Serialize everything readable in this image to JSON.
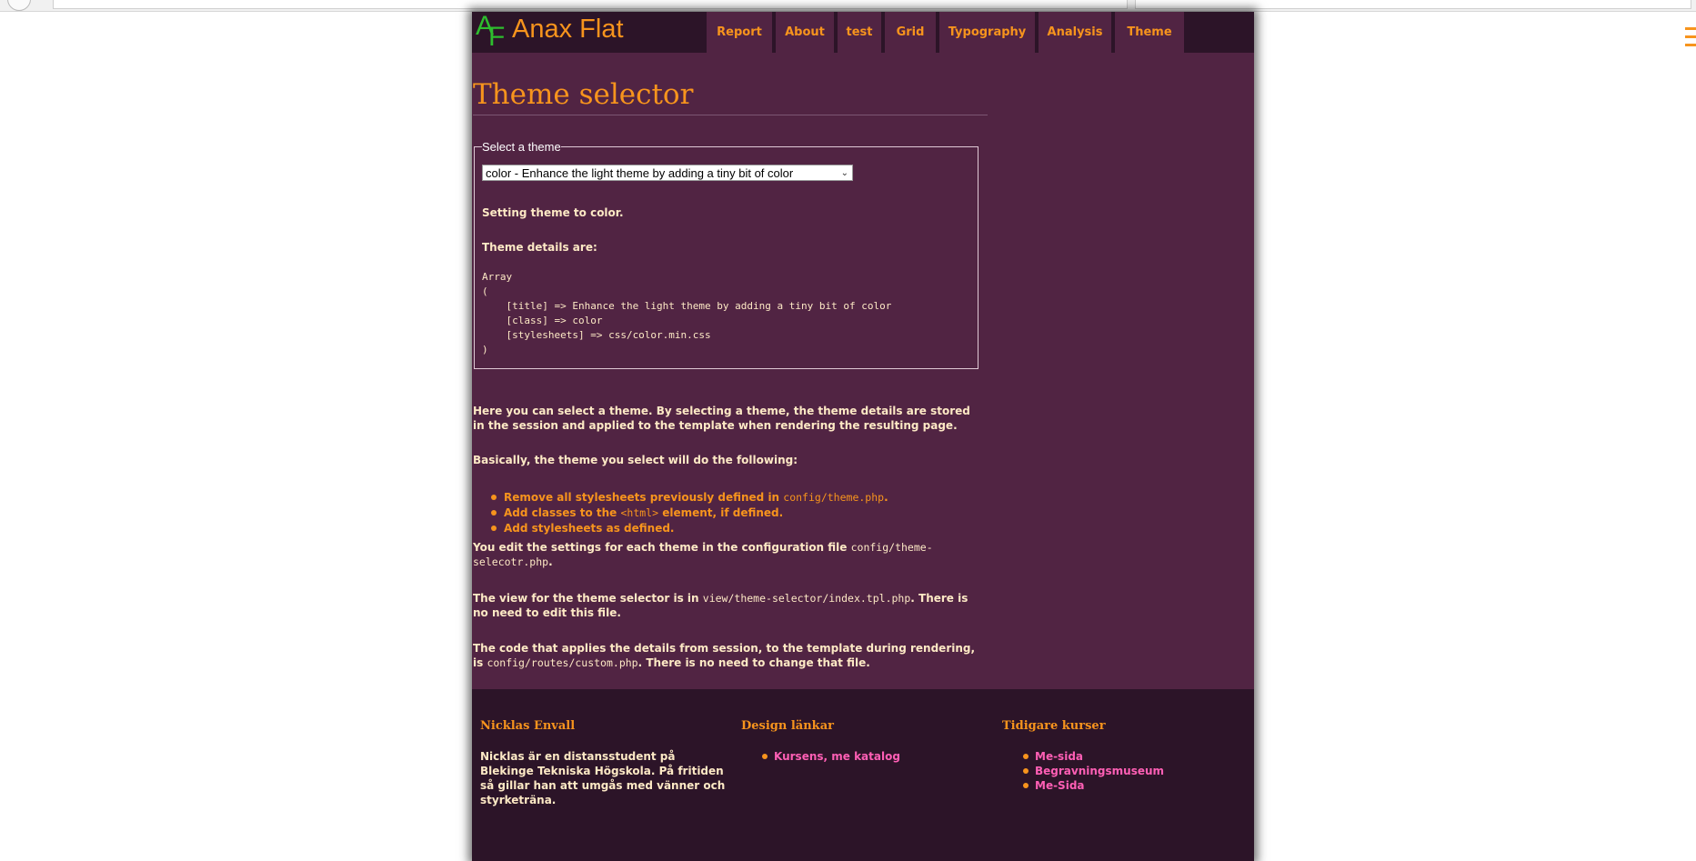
{
  "site": {
    "logo_letters": [
      "A",
      "F"
    ],
    "title": "Anax Flat"
  },
  "nav": {
    "items": [
      {
        "label": "Report"
      },
      {
        "label": "About"
      },
      {
        "label": "test"
      },
      {
        "label": "Grid"
      },
      {
        "label": "Typography"
      },
      {
        "label": "Analysis"
      },
      {
        "label": "Theme"
      }
    ]
  },
  "main": {
    "heading": "Theme selector",
    "form": {
      "legend": "Select a theme",
      "selected_option": "color - Enhance the light theme by adding a tiny bit of color",
      "status": "Setting theme to color.",
      "details_label": "Theme details are:",
      "dump_lines": [
        "Array",
        "(",
        "    [title] => Enhance the light theme by adding a tiny bit of color",
        "    [class] => color",
        "    [stylesheets] => css/color.min.css",
        ")"
      ]
    },
    "intro": "Here you can select a theme. By selecting a theme, the theme details are stored in the session and applied to the template when rendering the resulting page.",
    "basically": "Basically, the theme you select will do the following:",
    "bullets": [
      {
        "text": "Remove all stylesheets previously defined in ",
        "code": "config/theme.php",
        "tail": "."
      },
      {
        "text": "Add classes to the ",
        "code": "<html>",
        "tail": " element, if defined."
      },
      {
        "text": "Add stylesheets as defined.",
        "code": "",
        "tail": ""
      }
    ],
    "edit_settings": {
      "text": "You edit the settings for each theme in the configuration file ",
      "code": "config/theme-selecotr.php",
      "tail": "."
    },
    "view_file": {
      "text": "The view for the theme selector is in ",
      "code": "view/theme-selector/index.tpl.php",
      "tail": ". There is no need to edit this file."
    },
    "code_file": {
      "text": "The code that applies the details from session, to the template during rendering, is ",
      "code": "config/routes/custom.php",
      "tail": ". There is no need to change that file."
    }
  },
  "footer": {
    "col1": {
      "title": "Nicklas Envall",
      "text": "Nicklas är en distansstudent på Blekinge Tekniska Högskola. På fritiden så gillar han att umgås med vänner och styrketräna."
    },
    "col2": {
      "title": "Design länkar",
      "links": [
        "Kursens, me katalog"
      ]
    },
    "col3": {
      "title": "Tidigare kurser",
      "links": [
        "Me-sida",
        "Begravningsmuseum",
        "Me-Sida"
      ]
    }
  },
  "colors": {
    "accent": "#f7941d",
    "page_bg": "#512443",
    "header_bg": "#2c1428",
    "text": "#fde9c5",
    "link_pink": "#ff5fb5",
    "logo_green": "#2ebd2e"
  }
}
